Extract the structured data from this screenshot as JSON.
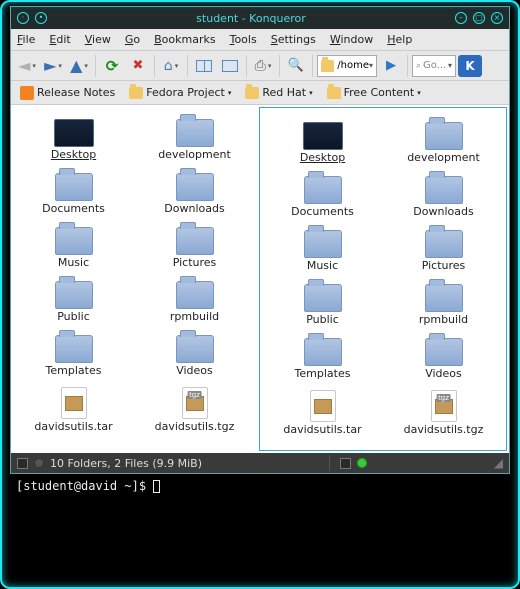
{
  "title": "student - Konqueror",
  "menu": {
    "items": [
      "File",
      "Edit",
      "View",
      "Go",
      "Bookmarks",
      "Tools",
      "Settings",
      "Window",
      "Help"
    ]
  },
  "toolbar": {
    "address": "/home",
    "go_placeholder": "Go..."
  },
  "bookmarks_bar": [
    "Release Notes",
    "Fedora Project",
    "Red Hat",
    "Free Content"
  ],
  "left_pane": {
    "items": [
      {
        "icon": "desktop",
        "label": "Desktop",
        "selected": true
      },
      {
        "icon": "folder",
        "label": "development"
      },
      {
        "icon": "folder",
        "label": "Documents"
      },
      {
        "icon": "folder",
        "label": "Downloads"
      },
      {
        "icon": "folder",
        "label": "Music"
      },
      {
        "icon": "folder",
        "label": "Pictures"
      },
      {
        "icon": "folder",
        "label": "Public"
      },
      {
        "icon": "folder",
        "label": "rpmbuild"
      },
      {
        "icon": "folder",
        "label": "Templates"
      },
      {
        "icon": "folder",
        "label": "Videos"
      },
      {
        "icon": "tar",
        "label": "davidsutils.tar"
      },
      {
        "icon": "tgz",
        "label": "davidsutils.tgz"
      }
    ]
  },
  "right_pane": {
    "active": true,
    "items": [
      {
        "icon": "desktop",
        "label": "Desktop",
        "selected": true
      },
      {
        "icon": "folder",
        "label": "development"
      },
      {
        "icon": "folder",
        "label": "Documents"
      },
      {
        "icon": "folder",
        "label": "Downloads"
      },
      {
        "icon": "folder",
        "label": "Music"
      },
      {
        "icon": "folder",
        "label": "Pictures"
      },
      {
        "icon": "folder",
        "label": "Public"
      },
      {
        "icon": "folder",
        "label": "rpmbuild"
      },
      {
        "icon": "folder",
        "label": "Templates"
      },
      {
        "icon": "folder",
        "label": "Videos"
      },
      {
        "icon": "tar",
        "label": "davidsutils.tar"
      },
      {
        "icon": "tgz",
        "label": "davidsutils.tgz"
      }
    ]
  },
  "status": "10 Folders, 2 Files (9.9 MiB)",
  "terminal": {
    "prompt": "[student@david ~]$ "
  },
  "tgz_tag": "tgz"
}
